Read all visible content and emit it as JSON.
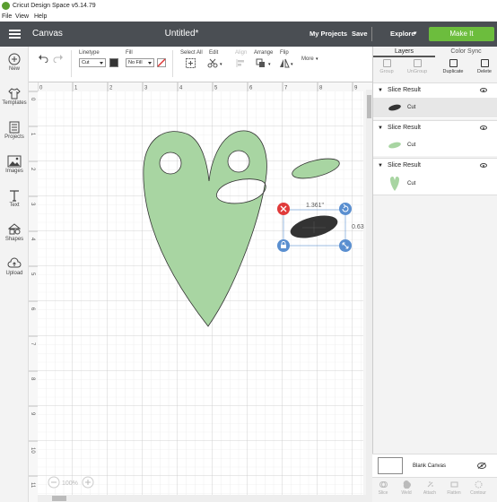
{
  "window": {
    "title": "Cricut Design Space  v5.14.79"
  },
  "menu": [
    "File",
    "View",
    "Help"
  ],
  "header": {
    "section": "Canvas",
    "document_title": "Untitled*",
    "my_projects": "My Projects",
    "save": "Save",
    "explore": "Explore",
    "make_it": "Make It"
  },
  "sidebar": [
    {
      "label": "New",
      "icon": "plus-icon"
    },
    {
      "label": "Templates",
      "icon": "shirt-icon"
    },
    {
      "label": "Projects",
      "icon": "projects-icon"
    },
    {
      "label": "Images",
      "icon": "image-icon"
    },
    {
      "label": "Text",
      "icon": "text-icon"
    },
    {
      "label": "Shapes",
      "icon": "shapes-icon"
    },
    {
      "label": "Upload",
      "icon": "upload-icon"
    }
  ],
  "toolbar": {
    "linetype_label": "Linetype",
    "linetype_value": "Cut",
    "fill_label": "Fill",
    "fill_value": "No Fill",
    "select_all": "Select All",
    "edit": "Edit",
    "align": "Align",
    "arrange": "Arrange",
    "flip": "Flip",
    "more": "More"
  },
  "ruler": {
    "top": [
      "0",
      "1",
      "2",
      "3",
      "4",
      "5",
      "6",
      "7",
      "8",
      "9"
    ],
    "left": [
      "0",
      "1",
      "2",
      "3",
      "4",
      "5",
      "6",
      "7",
      "8",
      "9",
      "10",
      "11"
    ]
  },
  "selection": {
    "width": "1.361\"",
    "height": "0.63"
  },
  "zoom": "100%",
  "layers_panel": {
    "tabs": [
      "Layers",
      "Color Sync"
    ],
    "actions": [
      {
        "label": "Group",
        "enabled": false
      },
      {
        "label": "UnGroup",
        "enabled": false
      },
      {
        "label": "Duplicate",
        "enabled": true
      },
      {
        "label": "Delete",
        "enabled": true
      }
    ],
    "layers": [
      {
        "name": "Slice Result",
        "op": "Cut",
        "color": "#333333",
        "selected": true
      },
      {
        "name": "Slice Result",
        "op": "Cut",
        "color": "#a8d5a2",
        "selected": false
      },
      {
        "name": "Slice Result",
        "op": "Cut",
        "color": "#a8d5a2",
        "selected": false
      }
    ],
    "blank_canvas": "Blank Canvas",
    "bottom_actions": [
      "Slice",
      "Weld",
      "Attach",
      "Flatten",
      "Contour"
    ]
  },
  "colors": {
    "header_bg": "#4a4e53",
    "make_it": "#6cbd3d",
    "shape_green": "#a8d5a2",
    "shape_dark": "#333333",
    "handle_red": "#e03b3b",
    "handle_blue": "#5a8fd0"
  }
}
